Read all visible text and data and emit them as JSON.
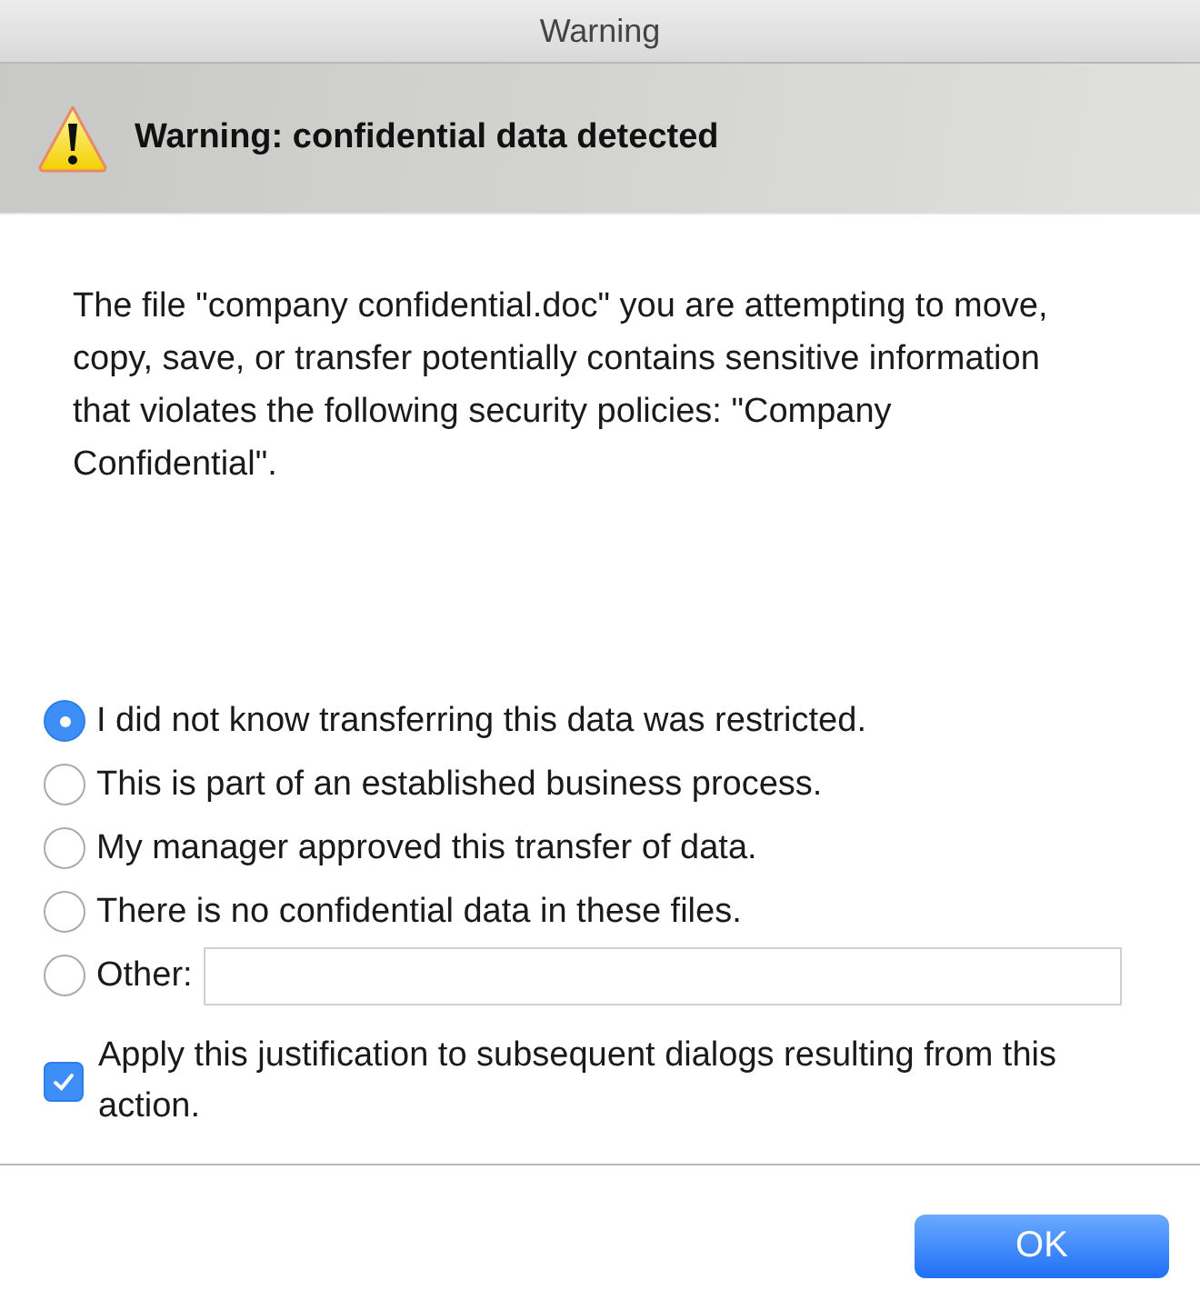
{
  "window": {
    "title": "Warning"
  },
  "header": {
    "title": "Warning: confidential data detected"
  },
  "message": "The file \"company confidential.doc\" you are attempting to move, copy, save, or transfer potentially contains sensitive information that violates the following security policies: \"Company Confidential\".",
  "options": [
    {
      "label": "I did not know transferring this data was restricted.",
      "selected": true,
      "kind": "plain"
    },
    {
      "label": "This is part of an established business process.",
      "selected": false,
      "kind": "plain"
    },
    {
      "label": "My manager approved this transfer of data.",
      "selected": false,
      "kind": "plain"
    },
    {
      "label": "There is no confidential data in these files.",
      "selected": false,
      "kind": "plain"
    },
    {
      "label": "Other:",
      "selected": false,
      "kind": "other"
    }
  ],
  "apply_checkbox": {
    "label": "Apply this justification to subsequent dialogs resulting from this action.",
    "checked": true
  },
  "buttons": [
    "OK"
  ]
}
